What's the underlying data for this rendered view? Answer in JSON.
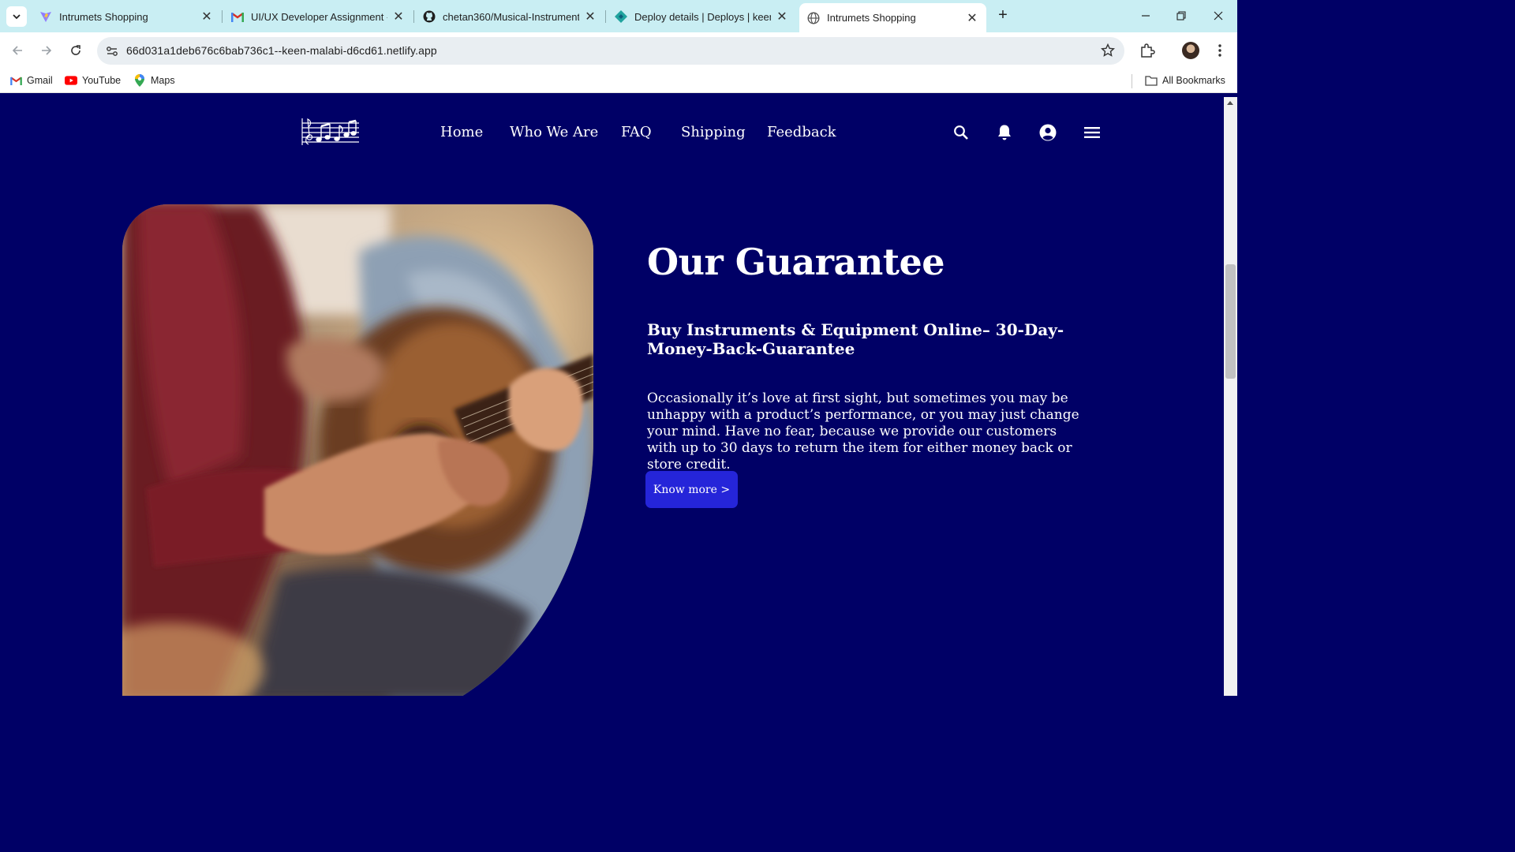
{
  "browser": {
    "tabs": [
      {
        "title": "Intrumets Shopping",
        "icon": "vite-icon"
      },
      {
        "title": "UI/UX Developer Assignment -",
        "icon": "gmail-icon"
      },
      {
        "title": "chetan360/Musical-Instruments",
        "icon": "github-icon"
      },
      {
        "title": "Deploy details | Deploys | keen-",
        "icon": "netlify-icon"
      },
      {
        "title": "Intrumets Shopping",
        "icon": "globe-icon",
        "active": true
      }
    ],
    "url": "66d031a1deb676c6bab736c1--keen-malabi-d6cd61.netlify.app",
    "bookmarks": [
      {
        "label": "Gmail"
      },
      {
        "label": "YouTube"
      },
      {
        "label": "Maps"
      }
    ],
    "all_bookmarks": "All Bookmarks"
  },
  "nav": {
    "items": [
      "Home",
      "Who We Are",
      "FAQ",
      "Shipping",
      "Feedback"
    ]
  },
  "hero": {
    "title": "Our Guarantee",
    "subtitle": "Buy Instruments & Equipment Online– 30-Day-Money-Back-Guarantee",
    "body": "Occasionally it’s love at first sight, but sometimes you may be unhappy with a product’s performance, or you may just change your mind. Have no fear, because we provide our customers with up to 30 days to return the item for either money back or store credit.",
    "cta": "Know more >"
  },
  "colors": {
    "page_bg": "#000066",
    "button": "#2525d9",
    "tabbar": "#c9eef3"
  }
}
